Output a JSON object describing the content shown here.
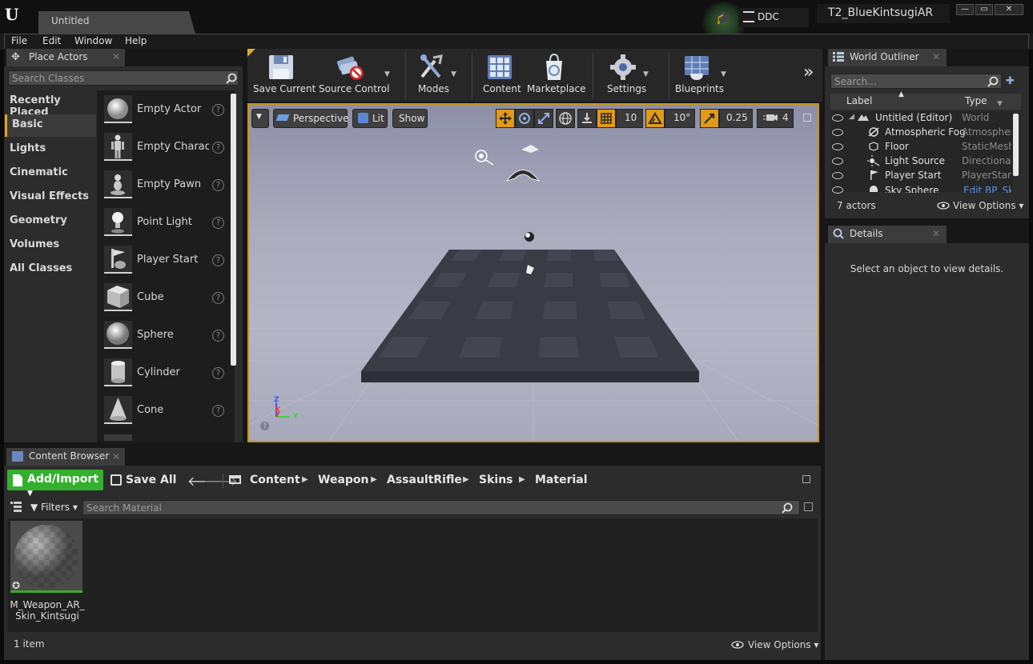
{
  "window": {
    "doc_tab": "Untitled",
    "ddc_label": "DDC",
    "project_name": "T2_BlueKintsugiAR",
    "min_glyph": "—",
    "max_glyph": "▭",
    "close_glyph": "✕"
  },
  "menu": [
    "File",
    "Edit",
    "Window",
    "Help"
  ],
  "place_actors": {
    "tab_title": "Place Actors",
    "search_placeholder": "Search Classes",
    "categories": [
      "Recently Placed",
      "Basic",
      "Lights",
      "Cinematic",
      "Visual Effects",
      "Geometry",
      "Volumes",
      "All Classes"
    ],
    "active_category": "Basic",
    "actors": [
      "Empty Actor",
      "Empty Character",
      "Empty Pawn",
      "Point Light",
      "Player Start",
      "Cube",
      "Sphere",
      "Cylinder",
      "Cone"
    ],
    "help_glyph": "?"
  },
  "toolbar": {
    "save_current": "Save Current",
    "source_control": "Source Control",
    "modes": "Modes",
    "content": "Content",
    "marketplace": "Marketplace",
    "settings": "Settings",
    "blueprints": "Blueprints",
    "overflow": "»"
  },
  "viewport": {
    "perspective": "Perspective",
    "lit": "Lit",
    "show": "Show",
    "grid_snap": "10",
    "rotation_snap": "10°",
    "scale_snap": "0.25",
    "camera_speed": "4",
    "axis_z": "Z",
    "axis_x": "X",
    "axis_y": "Y"
  },
  "world_outliner": {
    "tab_title": "World Outliner",
    "search_placeholder": "Search...",
    "col_label": "Label",
    "col_type": "Type",
    "rows": [
      {
        "label": "Untitled (Editor)",
        "type": "World"
      },
      {
        "label": "Atmospheric Fog",
        "type": "AtmosphericFog"
      },
      {
        "label": "Floor",
        "type": "StaticMeshActor"
      },
      {
        "label": "Light Source",
        "type": "DirectionalLight"
      },
      {
        "label": "Player Start",
        "type": "PlayerStart"
      },
      {
        "label": "Sky Sphere",
        "type": "Edit BP_Sky_Sphere"
      }
    ],
    "actor_count": "7 actors",
    "view_options": "View Options"
  },
  "details": {
    "tab_title": "Details",
    "empty_text": "Select an object to view details."
  },
  "content_browser": {
    "tab_title": "Content Browser",
    "add_import": "Add/Import",
    "save_all": "Save All",
    "breadcrumb": [
      "Content",
      "Weapon",
      "AssaultRifle",
      "Skins",
      "Material"
    ],
    "filters": "Filters",
    "search_placeholder": "Search Material",
    "asset_name": "M_Weapon_AR_Skin_Kintsugi",
    "item_count": "1 item",
    "view_options": "View Options"
  },
  "colors": {
    "accent": "#e29a16",
    "add_import_green": "#33b02e",
    "panel": "#2c2c2c"
  }
}
